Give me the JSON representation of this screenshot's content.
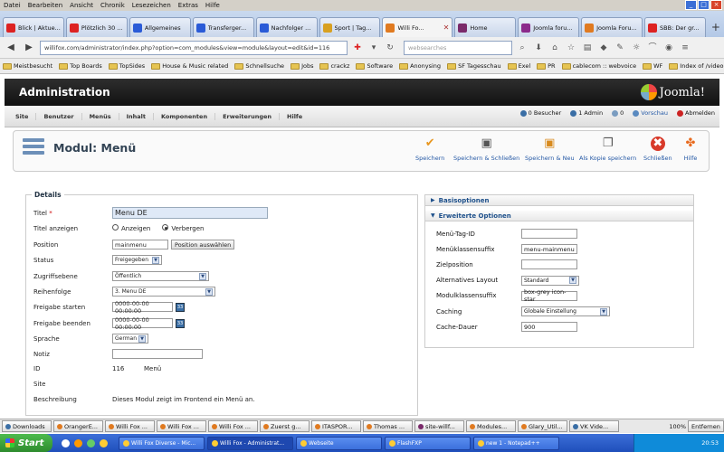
{
  "menubar": [
    "Datei",
    "Bearbeiten",
    "Ansicht",
    "Chronik",
    "Lesezeichen",
    "Extras",
    "Hilfe"
  ],
  "tabs": [
    {
      "label": "Blick | Aktue...",
      "color": "#d22"
    },
    {
      "label": "Plötzlich 30 ...",
      "color": "#d22"
    },
    {
      "label": "Allgemeines",
      "color": "#2a5bd7"
    },
    {
      "label": "Transferger...",
      "color": "#2a5bd7"
    },
    {
      "label": "Nachfolger ...",
      "color": "#2a5bd7"
    },
    {
      "label": "Sport | Tag...",
      "color": "#d8a020"
    },
    {
      "label": "Willi Fo...",
      "color": "#e07a20",
      "active": true
    },
    {
      "label": "Home",
      "color": "#7a2a6a"
    },
    {
      "label": "Joomla foru...",
      "color": "#8b2a8b"
    },
    {
      "label": "Joomla Foru...",
      "color": "#e07a20"
    },
    {
      "label": "SBB: Der gr...",
      "color": "#d22"
    }
  ],
  "url": "willifox.com/administrator/index.php?option=com_modules&view=module&layout=edit&id=116",
  "search_placeholder": "websearches",
  "bookmarks": [
    "Meistbesucht",
    "Top Boards",
    "TopSides",
    "House & Music related",
    "Schnellsuche",
    "Jobs",
    "crackz",
    "Software",
    "Anonysing",
    "SF Tagesschau",
    "Exel",
    "PR",
    "cablecom :: webvoice",
    "WF",
    "Index of /video"
  ],
  "header": {
    "title": "Administration",
    "logo": "Joomla!"
  },
  "jmenu": [
    "Site",
    "Benutzer",
    "Menüs",
    "Inhalt",
    "Komponenten",
    "Erweiterungen",
    "Hilfe"
  ],
  "status": {
    "visitors": "0 Besucher",
    "admins": "1 Admin",
    "messages": "0",
    "preview": "Vorschau",
    "logout": "Abmelden"
  },
  "page_title": "Modul: Menü",
  "toolbar": {
    "save": "Speichern",
    "save_close": "Speichern & Schließen",
    "save_new": "Speichern & Neu",
    "save_copy": "Als Kopie speichern",
    "close": "Schließen",
    "help": "Hilfe"
  },
  "details": {
    "legend": "Details",
    "title_label": "Titel",
    "title_value": "Menu DE",
    "show_title_label": "Titel anzeigen",
    "show": "Anzeigen",
    "hide": "Verbergen",
    "position_label": "Position",
    "position_value": "mainmenu",
    "position_btn": "Position auswählen",
    "status_label": "Status",
    "status_value": "Freigegeben",
    "access_label": "Zugriffsebene",
    "access_value": "Öffentlich",
    "order_label": "Reihenfolge",
    "order_value": "3. Menu DE",
    "start_label": "Freigabe starten",
    "start_value": "0000-00-00 00:00:00",
    "end_label": "Freigabe beenden",
    "end_value": "0000-00-00 00:00:00",
    "lang_label": "Sprache",
    "lang_value": "German",
    "note_label": "Notiz",
    "id_label": "ID",
    "id_value": "116",
    "id_type": "Menü",
    "site_label": "Site",
    "desc_label": "Beschreibung",
    "desc_value": "Dieses Modul zeigt im Frontend ein Menü an."
  },
  "panel": {
    "basic": "Basisoptionen",
    "advanced": "Erweiterte Optionen",
    "rows": [
      {
        "label": "Menü-Tag-ID",
        "value": "",
        "type": "input"
      },
      {
        "label": "Menüklassensuffix",
        "value": "menu-mainmenu",
        "type": "input"
      },
      {
        "label": "Zielposition",
        "value": "",
        "type": "input"
      },
      {
        "label": "Alternatives Layout",
        "value": "Standard",
        "type": "select"
      },
      {
        "label": "Modulklassensuffix",
        "value": "box-grey icon-star",
        "type": "input"
      },
      {
        "label": "Caching",
        "value": "Globale Einstellung",
        "type": "select"
      },
      {
        "label": "Cache-Dauer",
        "value": "900",
        "type": "input"
      }
    ]
  },
  "findbar": [
    "Downloads",
    "OrangerE...",
    "Willi Fox ...",
    "Willi Fox ...",
    "Willi Fox ...",
    "Zuerst g...",
    "ITASPOR...",
    "Thomas ...",
    "site-willf...",
    "Modules...",
    "Glary_Util...",
    "VK Vide..."
  ],
  "zoom": "100%",
  "remove": "Entfernen",
  "start": "Start",
  "tasks": [
    "Willi Fox Diverse - Mic...",
    "Willi Fox - Administrat...",
    "Webseite",
    "FlashFXP",
    "new 1 - Notepad++"
  ],
  "clock": "20:53"
}
